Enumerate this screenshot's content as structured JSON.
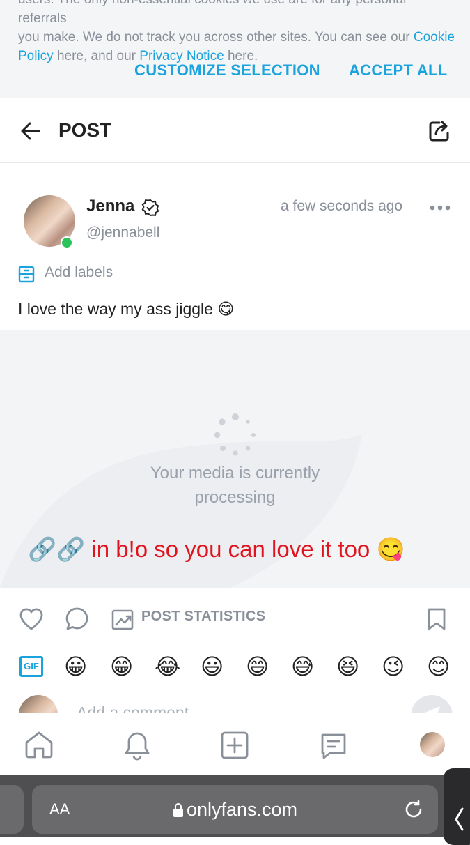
{
  "cookie": {
    "line1": "users. The only non-essential cookies we use are for any personal referrals",
    "line2_a": "you make. We do not track you across other sites. You can see our ",
    "line2_link": "Cookie",
    "line3_link1": "Policy",
    "line3_b": " here, and our ",
    "line3_link2": "Privacy Notice",
    "line3_c": " here.",
    "customize_label": "CUSTOMIZE SELECTION",
    "accept_label": "ACCEPT ALL"
  },
  "header": {
    "title": "POST"
  },
  "post": {
    "author_name": "Jenna",
    "author_handle": "@jennabell",
    "timestamp": "a few seconds ago",
    "labels_label": "Add labels",
    "text": "I love the way my ass jiggle 😋",
    "media_status_line1": "Your media is currently",
    "media_status_line2": "processing",
    "promo_links": "🔗🔗",
    "promo_text": " in b!o so you can love it too 😋",
    "stats_label": "POST STATISTICS"
  },
  "emoji_bar": {
    "gif_label": "GIF",
    "emojis": [
      "😀",
      "😁",
      "😂",
      "😃",
      "😄",
      "😅",
      "😆",
      "😉",
      "😊"
    ]
  },
  "comment": {
    "placeholder": "Add a comment..."
  },
  "browser": {
    "aa_label": "AA",
    "url": "onlyfans.com"
  },
  "colors": {
    "accent": "#1aa3dc",
    "promo": "#e0141e",
    "muted": "#8a9099",
    "online": "#2bc45a"
  }
}
